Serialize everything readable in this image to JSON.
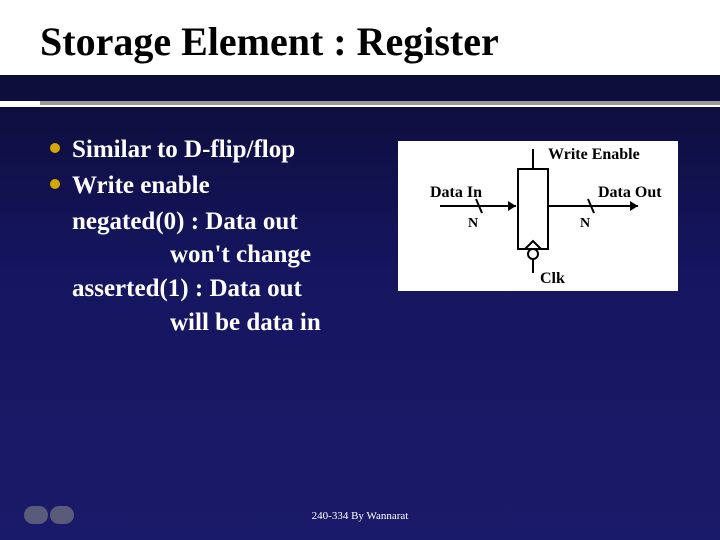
{
  "title": "Storage Element : Register",
  "bullets": [
    {
      "text": "Similar to D-flip/flop"
    },
    {
      "text": "Write enable"
    }
  ],
  "sublines": {
    "line1": "negated(0) : Data out",
    "line2": "won't change",
    "line3": "asserted(1) : Data out",
    "line4": "will be data in"
  },
  "diagram": {
    "write_enable": "Write Enable",
    "data_in": "Data In",
    "data_out": "Data Out",
    "n_left": "N",
    "n_right": "N",
    "clk": "Clk"
  },
  "footer": "240-334 By Wannarat"
}
